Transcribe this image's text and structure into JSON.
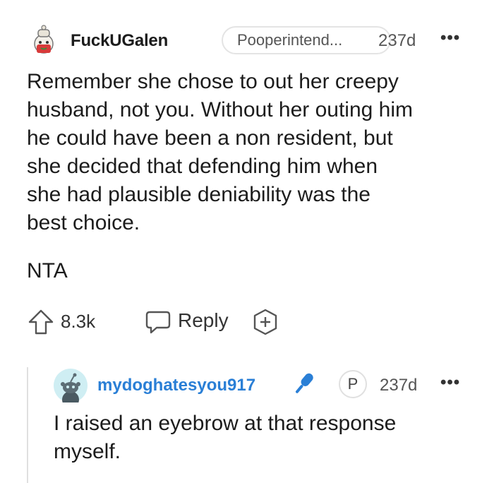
{
  "comment": {
    "username": "FuckUGalen",
    "flair": "Pooperintend...",
    "age": "237d",
    "more": "•••",
    "body_lines": [
      "Remember she chose to out her creepy",
      "husband, not you. Without her outing him",
      "he could have been a non resident, but",
      "she decided that defending him when",
      "she had plausible deniability was the",
      "best choice."
    ],
    "verdict": "NTA",
    "score": "8.3k",
    "reply_label": "Reply"
  },
  "reply": {
    "username": "mydoghatesyou917",
    "badge": "P",
    "age": "237d",
    "more": "•••",
    "body_lines": [
      "I raised an eyebrow at that response",
      "myself."
    ]
  },
  "colors": {
    "username_reply": "#2a7fd6",
    "mic": "#2a7fd6",
    "snoo_bg": "#cfeef3"
  },
  "icons": {
    "upvote": "upvote-arrow-icon",
    "reply": "speech-bubble-icon",
    "award": "award-plus-icon",
    "mic": "microphone-icon"
  }
}
